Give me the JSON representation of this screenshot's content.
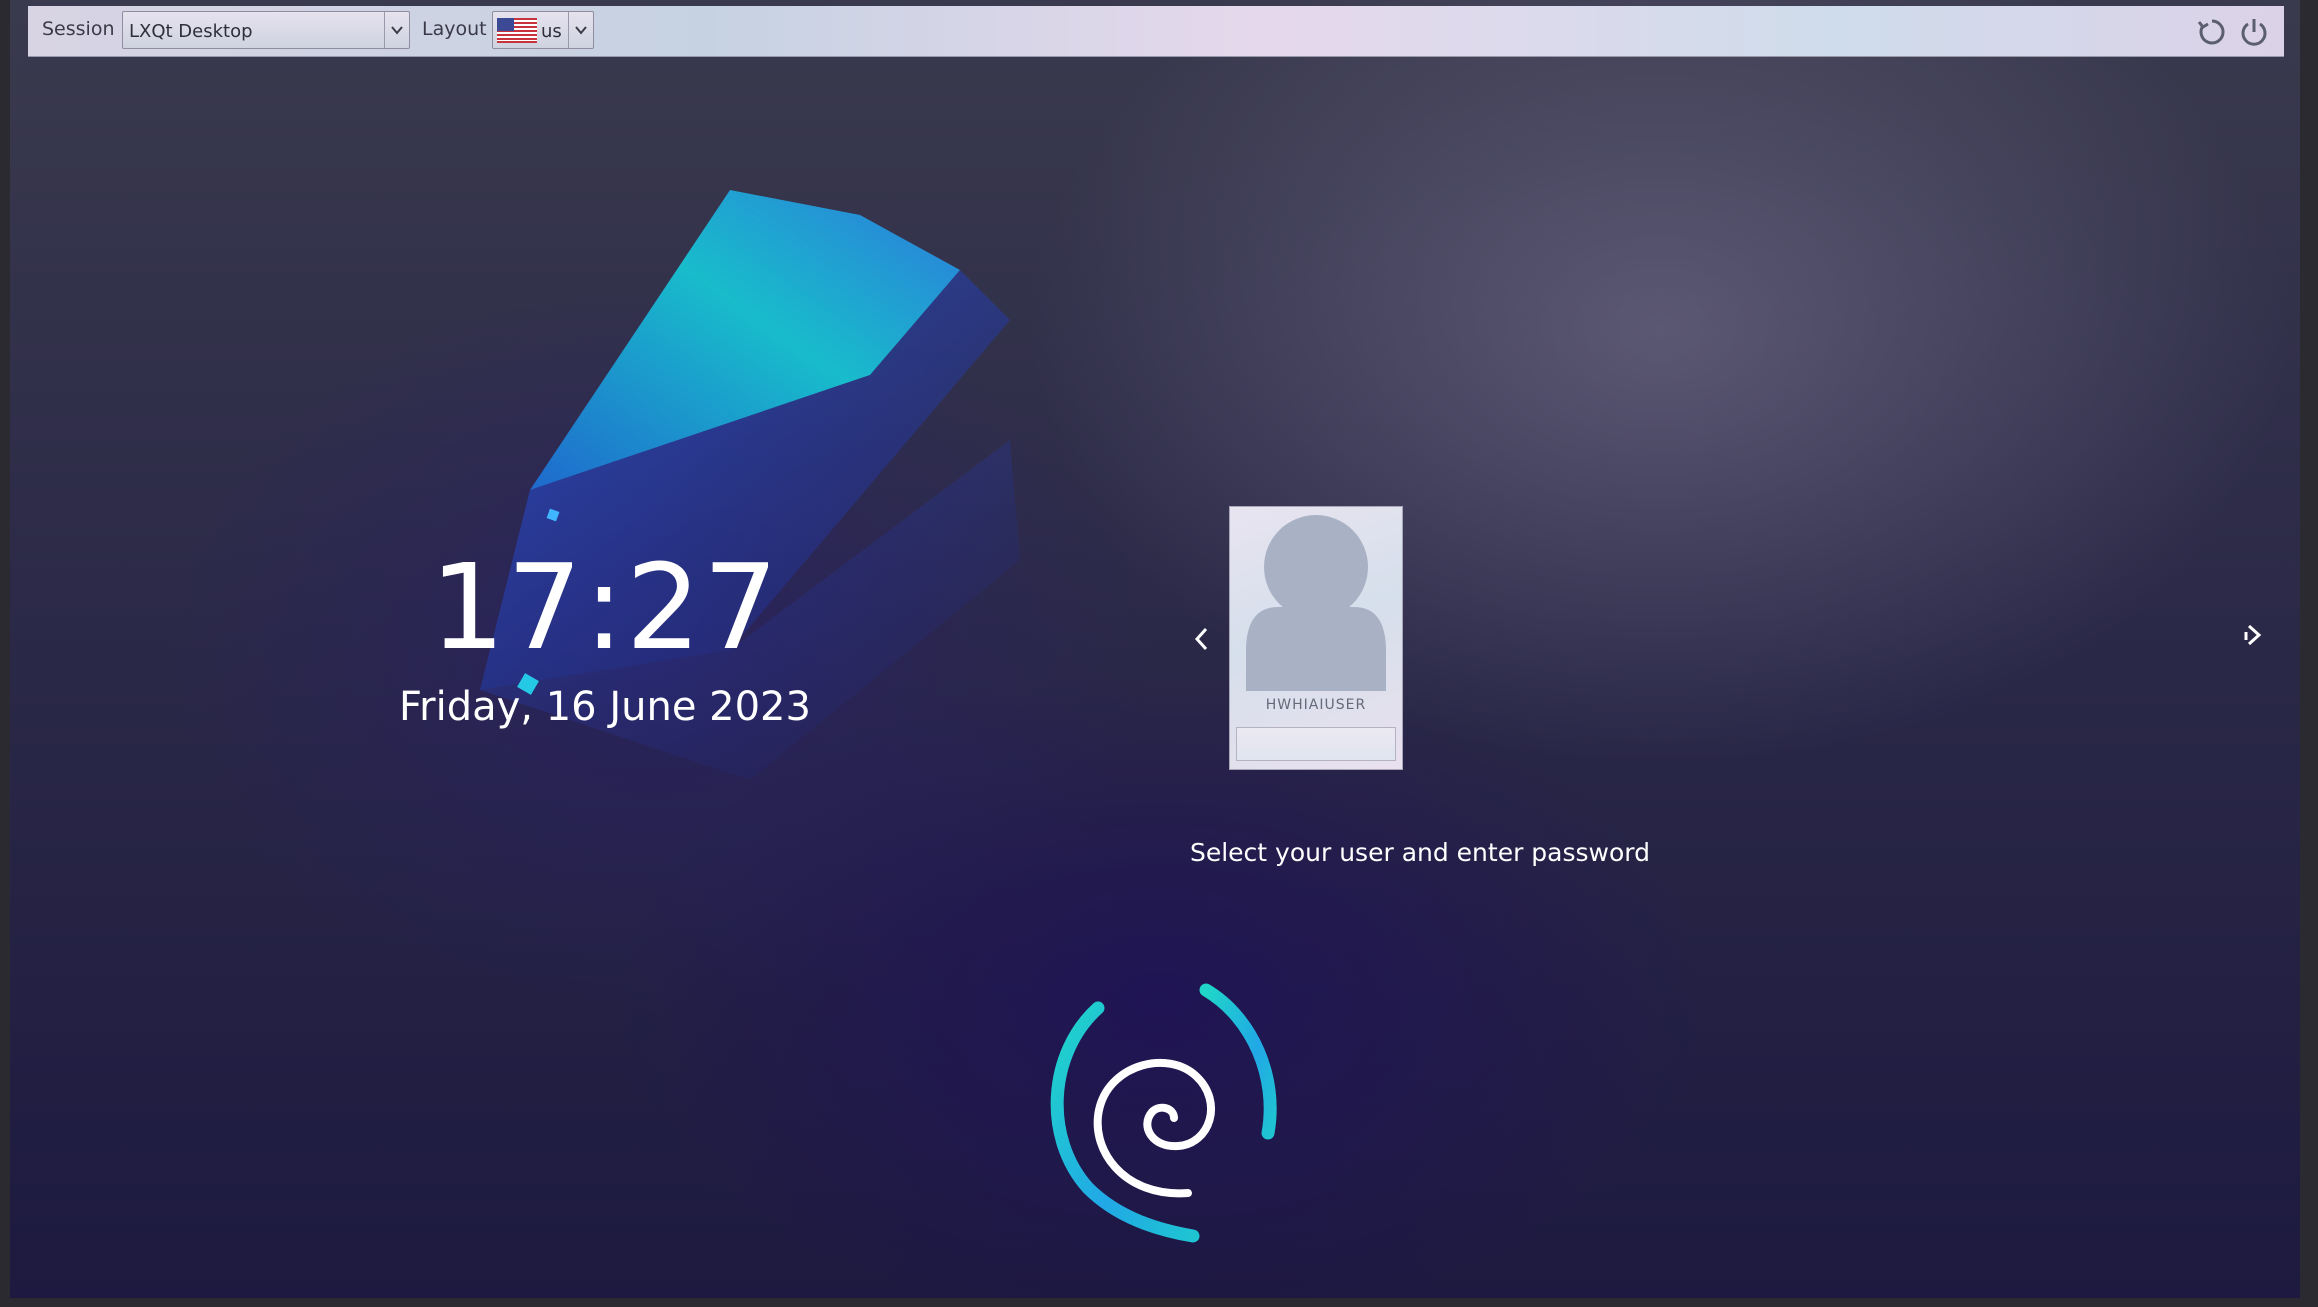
{
  "topbar": {
    "session_label": "Session",
    "session_value": "LXQt Desktop",
    "layout_label": "Layout",
    "layout_value": "us",
    "restart_icon": "restart-icon",
    "power_icon": "power-icon"
  },
  "clock": {
    "time": "17:27",
    "date": "Friday, 16 June 2023"
  },
  "login": {
    "username": "HWHIAIUSER",
    "password_value": "",
    "prompt": "Select your user and enter password"
  },
  "colors": {
    "wallpaper_dark": "#1d1940",
    "wallpaper_mid": "#3a3a4e",
    "accent_teal": "#1fd6c8",
    "accent_blue": "#2a6cff",
    "topbar": "#d8d4e4"
  }
}
